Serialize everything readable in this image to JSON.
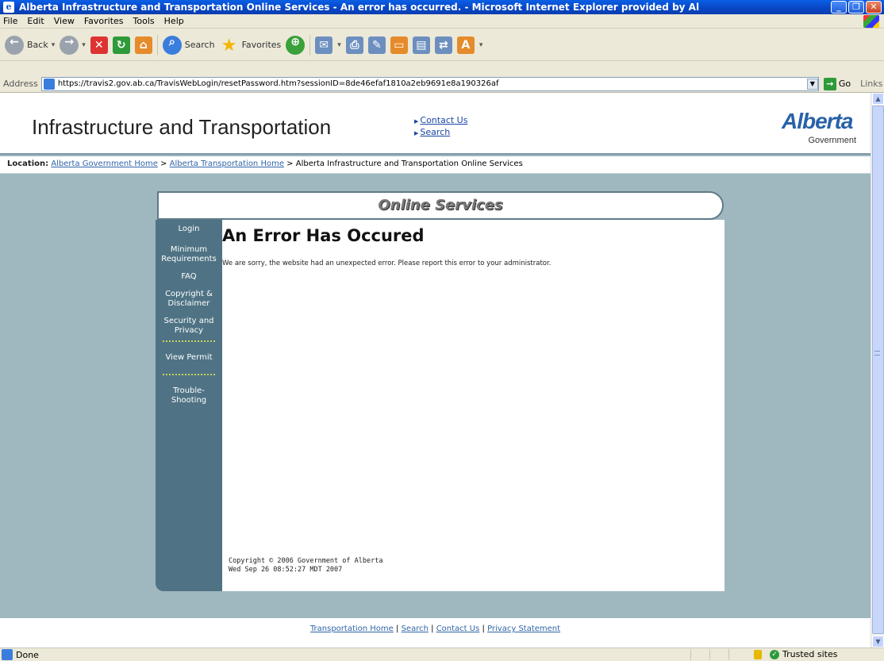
{
  "window": {
    "title": "Alberta Infrastructure and Transportation Online Services - An error has occurred. - Microsoft Internet Explorer provided by Al",
    "controls": [
      "_",
      "❐",
      "✕"
    ]
  },
  "menu": [
    "File",
    "Edit",
    "View",
    "Favorites",
    "Tools",
    "Help"
  ],
  "toolbar": {
    "back_label": "Back",
    "search_label": "Search",
    "favorites_label": "Favorites"
  },
  "address": {
    "label": "Address",
    "url": "https://travis2.gov.ab.ca/TravisWebLogin/resetPassword.htm?sessionID=8de46efaf1810a2eb9691e8a190326af",
    "go_label": "Go",
    "links_label": "Links"
  },
  "header": {
    "title": "Infrastructure and Transportation",
    "links": [
      "Contact Us",
      "Search"
    ],
    "logo_word": "Alberta",
    "logo_sub": "Government"
  },
  "location": {
    "label": "Location:",
    "crumbs": [
      "Alberta Government Home",
      "Alberta Transportation Home"
    ],
    "current": "Alberta Infrastructure and Transportation Online Services",
    "separator": ">"
  },
  "banner": {
    "title": "Online Services"
  },
  "nav": {
    "login": "Login",
    "min_req_1": "Minimum",
    "min_req_2": "Requirements",
    "faq": "FAQ",
    "copyright_1": "Copyright &",
    "copyright_2": "Disclaimer",
    "security_1": "Security and",
    "security_2": "Privacy",
    "view_permit": "View Permit",
    "trouble_1": "Trouble-",
    "trouble_2": "Shooting"
  },
  "main": {
    "heading": "An Error Has Occured",
    "message": "We are sorry, the website had an unexpected error. Please report this error to your administrator.",
    "copyright": "Copyright © 2006 Government of Alberta",
    "timestamp": "Wed Sep 26 08:52:27 MDT 2007"
  },
  "footer": {
    "links": [
      "Transportation Home",
      "Search",
      "Contact Us",
      "Privacy Statement"
    ],
    "separator": "|"
  },
  "status": {
    "text": "Done",
    "zone": "Trusted sites"
  }
}
